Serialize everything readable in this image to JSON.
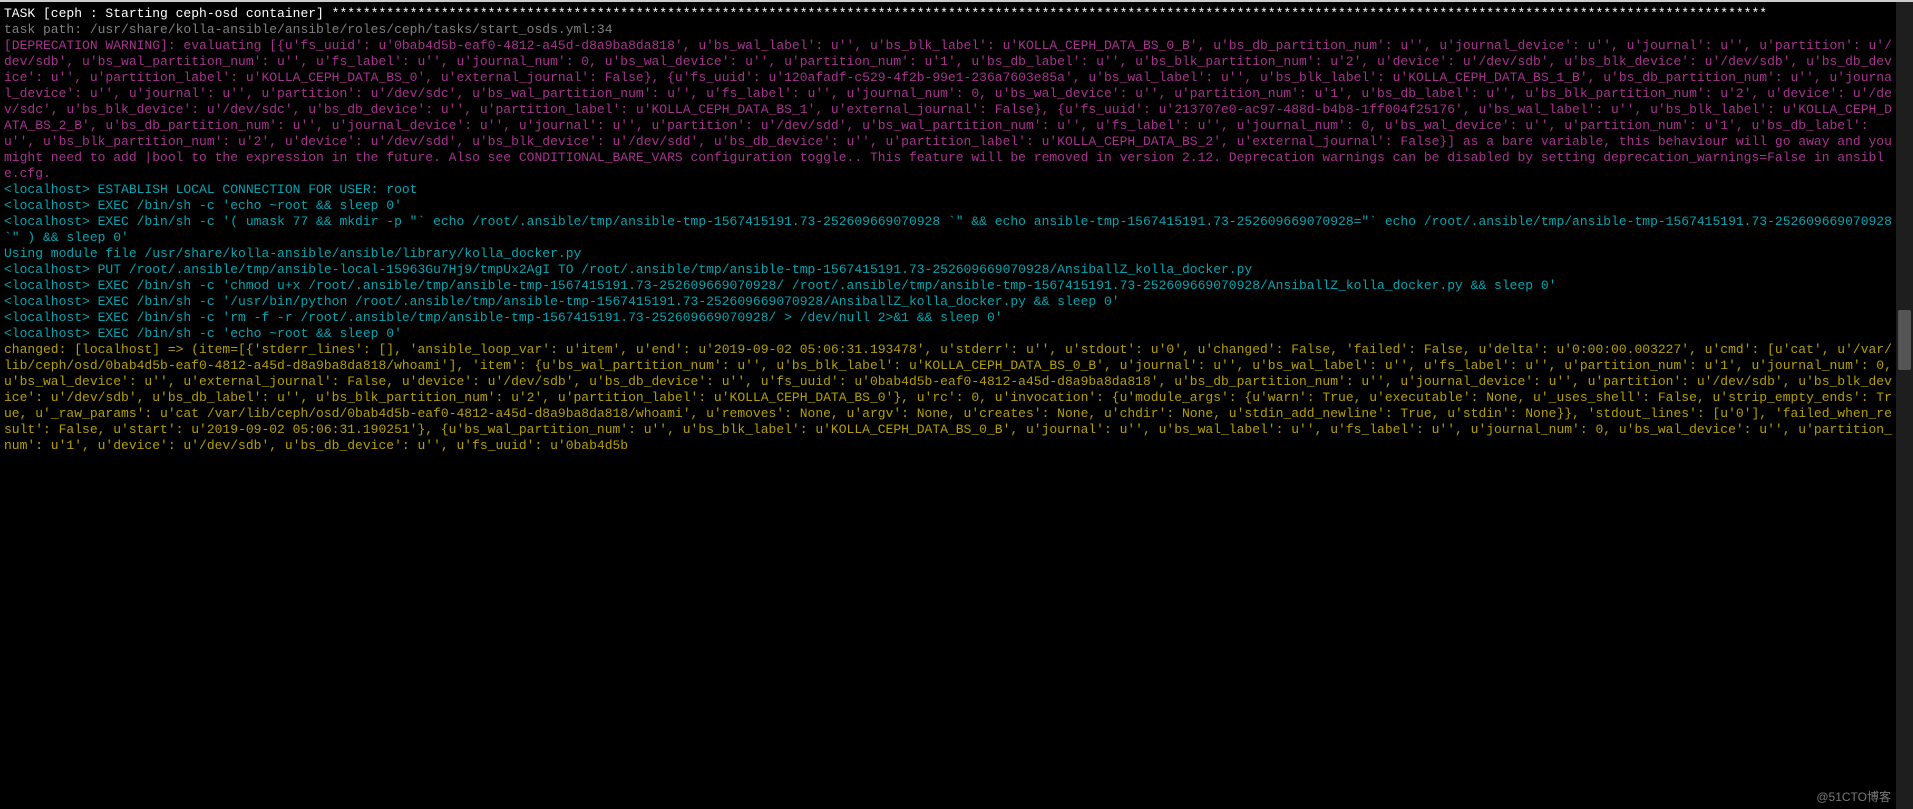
{
  "task_header": "TASK [ceph : Starting ceph-osd container] ****************************************************************************************************************************************************************************************",
  "task_path": "task path: /usr/share/kolla-ansible/ansible/roles/ceph/tasks/start_osds.yml:34",
  "deprecation_warning": "[DEPRECATION WARNING]: evaluating [{u'fs_uuid': u'0bab4d5b-eaf0-4812-a45d-d8a9ba8da818', u'bs_wal_label': u'', u'bs_blk_label': u'KOLLA_CEPH_DATA_BS_0_B', u'bs_db_partition_num': u'', u'journal_device': u'', u'journal': u'', u'partition': u'/dev/sdb', u'bs_wal_partition_num': u'', u'fs_label': u'', u'journal_num': 0, u'bs_wal_device': u'', u'partition_num': u'1', u'bs_db_label': u'', u'bs_blk_partition_num': u'2', u'device': u'/dev/sdb', u'bs_blk_device': u'/dev/sdb', u'bs_db_device': u'', u'partition_label': u'KOLLA_CEPH_DATA_BS_0', u'external_journal': False}, {u'fs_uuid': u'120afadf-c529-4f2b-99e1-236a7603e85a', u'bs_wal_label': u'', u'bs_blk_label': u'KOLLA_CEPH_DATA_BS_1_B', u'bs_db_partition_num': u'', u'journal_device': u'', u'journal': u'', u'partition': u'/dev/sdc', u'bs_wal_partition_num': u'', u'fs_label': u'', u'journal_num': 0, u'bs_wal_device': u'', u'partition_num': u'1', u'bs_db_label': u'', u'bs_blk_partition_num': u'2', u'device': u'/dev/sdc', u'bs_blk_device': u'/dev/sdc', u'bs_db_device': u'', u'partition_label': u'KOLLA_CEPH_DATA_BS_1', u'external_journal': False}, {u'fs_uuid': u'213707e0-ac97-488d-b4b8-1ff004f25176', u'bs_wal_label': u'', u'bs_blk_label': u'KOLLA_CEPH_DATA_BS_2_B', u'bs_db_partition_num': u'', u'journal_device': u'', u'journal': u'', u'partition': u'/dev/sdd', u'bs_wal_partition_num': u'', u'fs_label': u'', u'journal_num': 0, u'bs_wal_device': u'', u'partition_num': u'1', u'bs_db_label': u'', u'bs_blk_partition_num': u'2', u'device': u'/dev/sdd', u'bs_blk_device': u'/dev/sdd', u'bs_db_device': u'', u'partition_label': u'KOLLA_CEPH_DATA_BS_2', u'external_journal': False}] as a bare variable, this behaviour will go away and you might need to add |bool to the expression in the future. Also see CONDITIONAL_BARE_VARS configuration toggle.. This feature will be removed in version 2.12. Deprecation warnings can be disabled by setting deprecation_warnings=False in ansible.cfg.",
  "conn_establish": "<localhost> ESTABLISH LOCAL CONNECTION FOR USER: root",
  "exec_echo_root1": "<localhost> EXEC /bin/sh -c 'echo ~root && sleep 0'",
  "exec_mkdir": "<localhost> EXEC /bin/sh -c '( umask 77 && mkdir -p \"` echo /root/.ansible/tmp/ansible-tmp-1567415191.73-252609669070928 `\" && echo ansible-tmp-1567415191.73-252609669070928=\"` echo /root/.ansible/tmp/ansible-tmp-1567415191.73-252609669070928 `\" ) && sleep 0'",
  "using_module": "Using module file /usr/share/kolla-ansible/ansible/library/kolla_docker.py",
  "put_file": "<localhost> PUT /root/.ansible/tmp/ansible-local-15963Gu7Hj9/tmpUx2AgI TO /root/.ansible/tmp/ansible-tmp-1567415191.73-252609669070928/AnsiballZ_kolla_docker.py",
  "exec_chmod": "<localhost> EXEC /bin/sh -c 'chmod u+x /root/.ansible/tmp/ansible-tmp-1567415191.73-252609669070928/ /root/.ansible/tmp/ansible-tmp-1567415191.73-252609669070928/AnsiballZ_kolla_docker.py && sleep 0'",
  "exec_python": "<localhost> EXEC /bin/sh -c '/usr/bin/python /root/.ansible/tmp/ansible-tmp-1567415191.73-252609669070928/AnsiballZ_kolla_docker.py && sleep 0'",
  "exec_rm": "<localhost> EXEC /bin/sh -c 'rm -f -r /root/.ansible/tmp/ansible-tmp-1567415191.73-252609669070928/ > /dev/null 2>&1 && sleep 0'",
  "exec_echo_root2": "<localhost> EXEC /bin/sh -c 'echo ~root && sleep 0'",
  "changed_output": "changed: [localhost] => (item=[{'stderr_lines': [], 'ansible_loop_var': u'item', u'end': u'2019-09-02 05:06:31.193478', u'stderr': u'', u'stdout': u'0', u'changed': False, 'failed': False, u'delta': u'0:00:00.003227', u'cmd': [u'cat', u'/var/lib/ceph/osd/0bab4d5b-eaf0-4812-a45d-d8a9ba8da818/whoami'], 'item': {u'bs_wal_partition_num': u'', u'bs_blk_label': u'KOLLA_CEPH_DATA_BS_0_B', u'journal': u'', u'bs_wal_label': u'', u'fs_label': u'', u'partition_num': u'1', u'journal_num': 0, u'bs_wal_device': u'', u'external_journal': False, u'device': u'/dev/sdb', u'bs_db_device': u'', u'fs_uuid': u'0bab4d5b-eaf0-4812-a45d-d8a9ba8da818', u'bs_db_partition_num': u'', u'journal_device': u'', u'partition': u'/dev/sdb', u'bs_blk_device': u'/dev/sdb', u'bs_db_label': u'', u'bs_blk_partition_num': u'2', u'partition_label': u'KOLLA_CEPH_DATA_BS_0'}, u'rc': 0, u'invocation': {u'module_args': {u'warn': True, u'executable': None, u'_uses_shell': False, u'strip_empty_ends': True, u'_raw_params': u'cat /var/lib/ceph/osd/0bab4d5b-eaf0-4812-a45d-d8a9ba8da818/whoami', u'removes': None, u'argv': None, u'creates': None, u'chdir': None, u'stdin_add_newline': True, u'stdin': None}}, 'stdout_lines': [u'0'], 'failed_when_result': False, u'start': u'2019-09-02 05:06:31.190251'}, {u'bs_wal_partition_num': u'', u'bs_blk_label': u'KOLLA_CEPH_DATA_BS_0_B', u'journal': u'', u'bs_wal_label': u'', u'fs_label': u'', u'journal_num': 0, u'bs_wal_device': u'', u'partition_num': u'1', u'device': u'/dev/sdb', u'bs_db_device': u'', u'fs_uuid': u'0bab4d5b",
  "watermark": "@51CTO博客"
}
